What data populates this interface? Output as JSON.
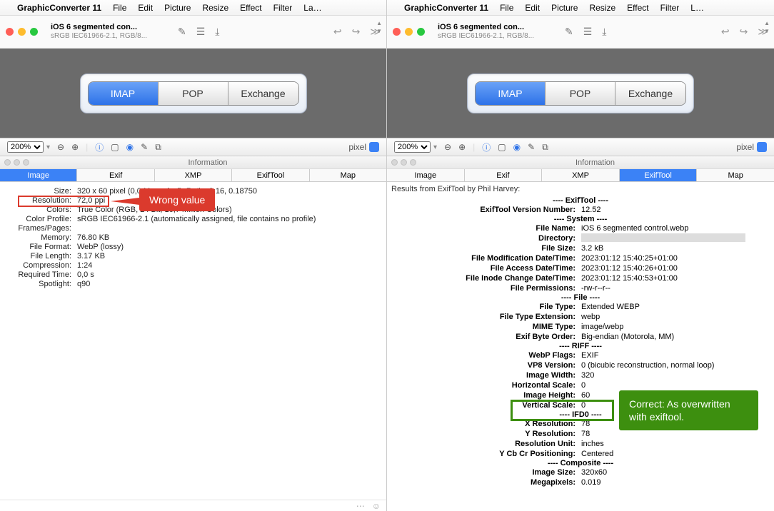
{
  "menubar": {
    "apple": "",
    "app": "GraphicConverter 11",
    "items": [
      "File",
      "Edit",
      "Picture",
      "Resize",
      "Effect",
      "Filter"
    ],
    "last_left": "La…",
    "last_right": "L…"
  },
  "titlebar": {
    "title": "iOS 6 segmented con...",
    "subtitle": "sRGB IEC61966-2.1, RGB/8..."
  },
  "segmented": {
    "items": [
      "IMAP",
      "POP",
      "Exchange"
    ],
    "active": 0
  },
  "toolbar2": {
    "zoom": "200%",
    "unit": "pixel"
  },
  "info_window": {
    "title": "Information"
  },
  "left": {
    "tabs": [
      "Image",
      "Exif",
      "XMP",
      "ExifTool",
      "Map"
    ],
    "active": 0,
    "rows": [
      {
        "k": "Size:",
        "v": "320 x 60 pixel (0,0 Megapixel), Ratio: 3:16, 0.18750"
      },
      {
        "k": "Resolution:",
        "v": "72,0 ppi"
      },
      {
        "k": "Colors:",
        "v": "True Color (RGB, 24 Bit, 16,7 Million Colors)"
      },
      {
        "k": "Color Profile:",
        "v": "sRGB IEC61966-2.1 (automatically assigned, file contains no profile)"
      },
      {
        "k": "Frames/Pages:",
        "v": ""
      },
      {
        "k": "Memory:",
        "v": "76.80 KB"
      },
      {
        "k": "File Format:",
        "v": "WebP (lossy)"
      },
      {
        "k": "File Length:",
        "v": "3.17 KB"
      },
      {
        "k": "Compression:",
        "v": "1:24"
      },
      {
        "k": "Required Time:",
        "v": "0,0 s"
      },
      {
        "k": "Spotlight:",
        "v": "q90"
      }
    ],
    "callout": "Wrong value"
  },
  "right": {
    "tabs": [
      "Image",
      "Exif",
      "XMP",
      "ExifTool",
      "Map"
    ],
    "active": 3,
    "header": "Results from ExifTool by Phil Harvey:",
    "sections": [
      {
        "title": "---- ExifTool ----",
        "rows": [
          {
            "k": "ExifTool Version Number:",
            "v": "12.52"
          }
        ]
      },
      {
        "title": "---- System ----",
        "rows": [
          {
            "k": "File Name:",
            "v": "iOS 6 segmented control.webp"
          },
          {
            "k": "Directory:",
            "v": "",
            "masked": true
          },
          {
            "k": "File Size:",
            "v": "3.2 kB"
          },
          {
            "k": "File Modification Date/Time:",
            "v": "2023:01:12 15:40:25+01:00"
          },
          {
            "k": "File Access Date/Time:",
            "v": "2023:01:12 15:40:26+01:00"
          },
          {
            "k": "File Inode Change Date/Time:",
            "v": "2023:01:12 15:40:53+01:00"
          },
          {
            "k": "File Permissions:",
            "v": "-rw-r--r--"
          }
        ]
      },
      {
        "title": "---- File ----",
        "rows": [
          {
            "k": "File Type:",
            "v": "Extended WEBP"
          },
          {
            "k": "File Type Extension:",
            "v": "webp"
          },
          {
            "k": "MIME Type:",
            "v": "image/webp"
          },
          {
            "k": "Exif Byte Order:",
            "v": "Big-endian (Motorola, MM)"
          }
        ]
      },
      {
        "title": "---- RIFF ----",
        "rows": [
          {
            "k": "WebP Flags:",
            "v": "EXIF"
          },
          {
            "k": "VP8 Version:",
            "v": "0 (bicubic reconstruction, normal loop)"
          },
          {
            "k": "Image Width:",
            "v": "320"
          },
          {
            "k": "Horizontal Scale:",
            "v": "0"
          },
          {
            "k": "Image Height:",
            "v": "60"
          },
          {
            "k": "Vertical Scale:",
            "v": "0"
          }
        ]
      },
      {
        "title": "---- IFD0 ----",
        "rows": [
          {
            "k": "X Resolution:",
            "v": "78"
          },
          {
            "k": "Y Resolution:",
            "v": "78"
          },
          {
            "k": "Resolution Unit:",
            "v": "inches"
          },
          {
            "k": "Y Cb Cr Positioning:",
            "v": "Centered"
          }
        ]
      },
      {
        "title": "---- Composite ----",
        "rows": [
          {
            "k": "Image Size:",
            "v": "320x60"
          },
          {
            "k": "Megapixels:",
            "v": "0.019"
          }
        ]
      }
    ],
    "callout": "Correct: As overwritten with exiftool."
  }
}
